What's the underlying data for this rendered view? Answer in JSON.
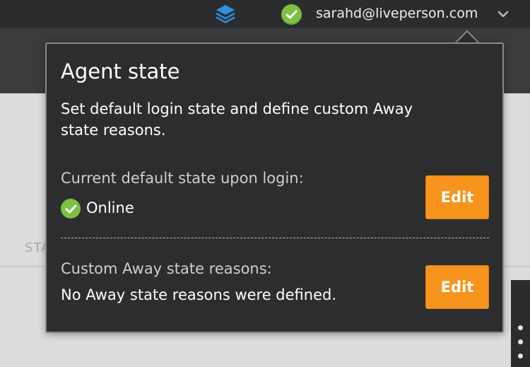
{
  "header": {
    "user_email": "sarahd@liveperson.com",
    "status": "online",
    "icons": [
      "layers-icon",
      "check-circle-icon",
      "chevron-down-icon"
    ]
  },
  "background": {
    "tab_label_partial": "STA"
  },
  "popover": {
    "title": "Agent state",
    "description": "Set default login state and define custom Away state reasons.",
    "default_state": {
      "label": "Current default state upon login:",
      "value": "Online",
      "edit_label": "Edit"
    },
    "away_reasons": {
      "label": "Custom Away state reasons:",
      "value": "No Away state reasons were defined.",
      "edit_label": "Edit"
    }
  },
  "colors": {
    "accent_orange": "#f7941d",
    "online_green": "#7cc142",
    "layers_blue": "#2f8fe0",
    "popover_bg": "#2c2d2f"
  }
}
